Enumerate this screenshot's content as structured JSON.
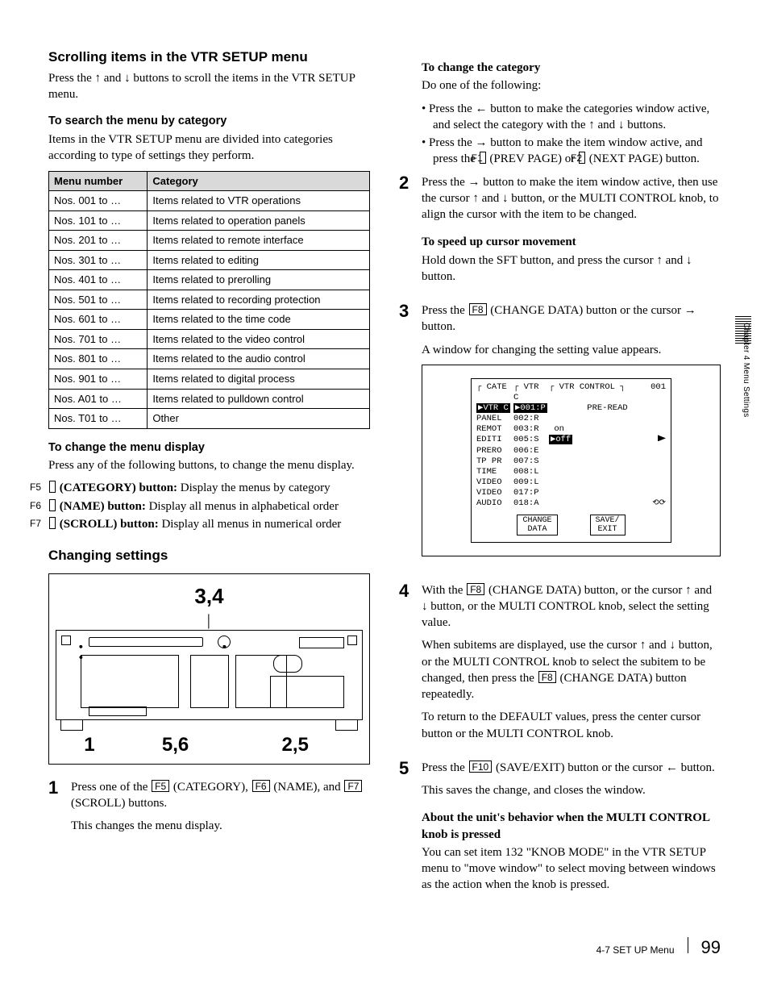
{
  "left": {
    "h_scroll": "Scrolling items in the VTR SETUP menu",
    "scroll_para_a": "Press the ",
    "scroll_para_b": " and ",
    "scroll_para_c": " buttons to scroll the items in the VTR SETUP menu.",
    "sub_search": "To search the menu by category",
    "search_para": "Items in the VTR SETUP menu are divided into categories according to type of settings they perform.",
    "table": {
      "h1": "Menu number",
      "h2": "Category",
      "rows": [
        [
          "Nos. 001 to …",
          "Items related to VTR operations"
        ],
        [
          "Nos. 101 to …",
          "Items related to operation panels"
        ],
        [
          "Nos. 201 to …",
          "Items related to remote interface"
        ],
        [
          "Nos. 301 to …",
          "Items related to editing"
        ],
        [
          "Nos. 401 to …",
          "Items related to prerolling"
        ],
        [
          "Nos. 501 to …",
          "Items related to recording protection"
        ],
        [
          "Nos. 601 to …",
          "Items related to the time code"
        ],
        [
          "Nos. 701 to …",
          "Items related to the video control"
        ],
        [
          "Nos. 801 to …",
          "Items related to the audio control"
        ],
        [
          "Nos. 901 to …",
          "Items related to digital process"
        ],
        [
          "Nos. A01 to …",
          "Items related to pulldown control"
        ],
        [
          "Nos. T01 to …",
          "Other"
        ]
      ]
    },
    "sub_change_disp": "To change the menu display",
    "change_disp_para": "Press any of the following buttons, to change the menu display.",
    "f5_label": "F5",
    "f5_bold": " (CATEGORY) button:",
    "f5_rest": " Display the menus by category",
    "f6_label": "F6",
    "f6_bold": " (NAME) button:",
    "f6_rest": " Display all menus in alphabetical order",
    "f7_label": "F7",
    "f7_bold": " (SCROLL) button:",
    "f7_rest": " Display all menus in numerical order",
    "h_changing": "Changing settings",
    "dev_top": "3,4",
    "dev_b1": "1",
    "dev_b2": "5,6",
    "dev_b3": "2,5",
    "step1_num": "1",
    "step1_a": "Press one of the ",
    "step1_b": " (CATEGORY), ",
    "step1_c": " (NAME), and ",
    "step1_d": " (SCROLL) buttons.",
    "step1_p2": "This changes the menu display."
  },
  "right": {
    "sub_change_cat": "To change the category",
    "cc_intro": "Do one of the following:",
    "cc_b1_a": "Press  the  ",
    "cc_b1_b": " button to make the categories window active, and select the category with the ",
    "cc_b1_c": " and  ",
    "cc_b1_d": " buttons.",
    "cc_b2_a": "Press the  ",
    "cc_b2_b": "  button  to make the item window active, and press the ",
    "cc_b2_c": " (PREV PAGE) or ",
    "cc_b2_d": " (NEXT PAGE) button.",
    "f1": "F1",
    "f2": "F2",
    "step2_num": "2",
    "step2_a": "Press the ",
    "step2_b": " button to make the item window active, then use the cursor ",
    "step2_c": " and ",
    "step2_d": " button, or the MULTI CONTROL knob, to align the cursor with the item to be changed.",
    "sub_speed": "To speed up cursor movement",
    "speed_a": "Hold down the SFT button, and press the cursor ",
    "speed_b": " and ",
    "speed_c": " button.",
    "step3_num": "3",
    "step3_a": "Press the ",
    "f8": "F8",
    "step3_b": " (CHANGE DATA) button or the cursor ",
    "step3_c": " button.",
    "step3_p2": "A window for changing the setting value appears.",
    "screen": {
      "title_l": "CATE",
      "title_m": "VTR C",
      "title_r": "VTR CONTROL",
      "title_no": "001",
      "colA": [
        "▶VTR C",
        "PANEL",
        "REMOT",
        "EDITI",
        "PRERO",
        "TP PR",
        "TIME",
        "VIDEO",
        "VIDEO",
        "AUDIO"
      ],
      "colB": [
        "▶001:P",
        "002:R",
        "003:R",
        "005:S",
        "006:E",
        "007:S",
        "008:L",
        "009:L",
        "017:P",
        "018:A"
      ],
      "pre": "PRE-READ",
      "on": "on",
      "off": "▶off",
      "btn1a": "CHANGE",
      "btn1b": "DATA",
      "btn2a": "SAVE/",
      "btn2b": "EXIT"
    },
    "step4_num": "4",
    "step4_a": "With the ",
    "step4_b": " (CHANGE DATA) button, or the cursor ",
    "step4_c": " and ",
    "step4_d": " button, or the MULTI  CONTROL knob, select the setting value.",
    "step4_p2_a": "When subitems are displayed, use the cursor ",
    "step4_p2_b": " and ",
    "step4_p2_c": " button, or the MULTI  CONTROL knob to select the subitem to be changed, then press the ",
    "step4_p2_d": " (CHANGE DATA) button repeatedly.",
    "step4_p3": "To return to the DEFAULT values, press the center cursor button or the MULTI CONTROL knob.",
    "step5_num": "5",
    "f10": "F10",
    "step5_a": "Press the ",
    "step5_b": " (SAVE/EXIT) button or the cursor ",
    "step5_c": " button.",
    "step5_p2": "This saves the change, and closes the window.",
    "sub_about": "About the unit's behavior when the MULTI CONTROL knob is pressed",
    "about_para": "You can set item 132 \"KNOB MODE\" in the VTR SETUP menu to \"move window\" to select moving between windows as the action when the knob is pressed."
  },
  "side_tab": "Chapter 4  Menu Settings",
  "footer_left": "4-7 SET UP Menu",
  "footer_page": "99"
}
